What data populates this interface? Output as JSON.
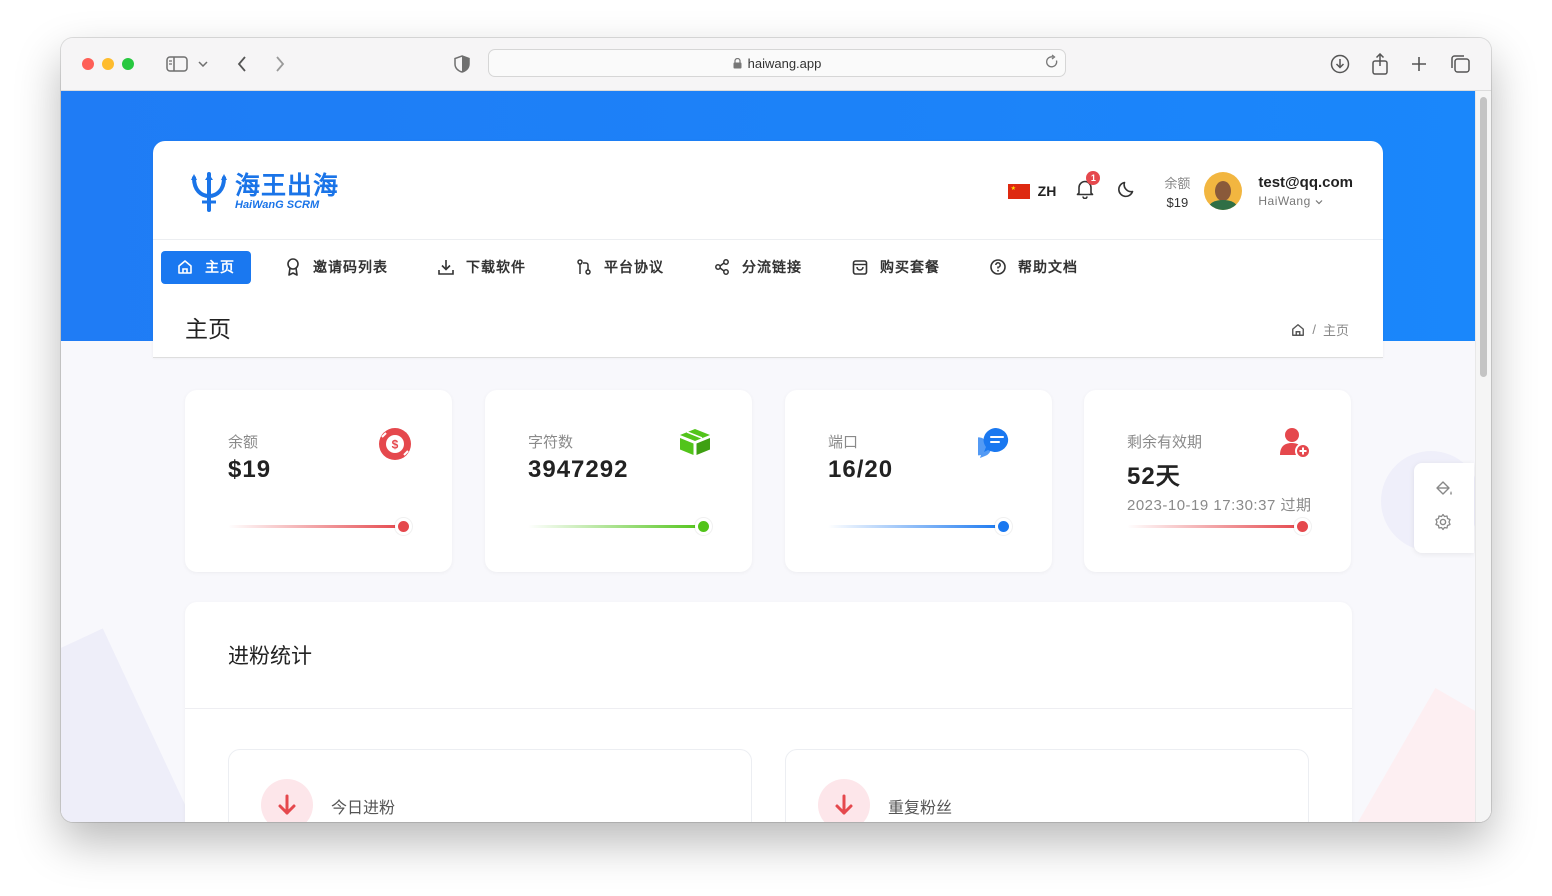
{
  "browser": {
    "url": "haiwang.app"
  },
  "brand": {
    "name": "海王出海",
    "subtitle": "HaiWanG SCRM"
  },
  "header": {
    "language": "ZH",
    "notification_count": "1",
    "balance_label": "余额",
    "balance_value": "$19",
    "user_email": "test@qq.com",
    "user_name": "HaiWang"
  },
  "nav": {
    "items": [
      {
        "label": "主页",
        "icon": "home-icon",
        "active": true
      },
      {
        "label": "邀请码列表",
        "icon": "award-icon"
      },
      {
        "label": "下载软件",
        "icon": "download-icon"
      },
      {
        "label": "平台协议",
        "icon": "git-compare-icon"
      },
      {
        "label": "分流链接",
        "icon": "share-icon"
      },
      {
        "label": "购买套餐",
        "icon": "shopping-bag-icon"
      },
      {
        "label": "帮助文档",
        "icon": "help-circle-icon"
      }
    ]
  },
  "page": {
    "title": "主页",
    "breadcrumb_current": "主页"
  },
  "stats": [
    {
      "label": "余额",
      "value": "$19",
      "icon": "dollar-circle-icon",
      "color": "#e5484d"
    },
    {
      "label": "字符数",
      "value": "3947292",
      "icon": "package-icon",
      "color": "#52c41a"
    },
    {
      "label": "端口",
      "value": "16/20",
      "icon": "chat-bubbles-icon",
      "color": "#1a78f0"
    },
    {
      "label": "剩余有效期",
      "value": "52天",
      "sub": "2023-10-19 17:30:37 过期",
      "icon": "user-plus-icon",
      "color": "#e5484d"
    }
  ],
  "fans": {
    "title": "进粉统计",
    "boxes": [
      {
        "label": "今日进粉",
        "icon": "arrow-down-icon"
      },
      {
        "label": "重复粉丝",
        "icon": "arrow-down-icon"
      }
    ]
  },
  "colors": {
    "primary": "#1a78f0",
    "danger": "#e5484d",
    "success": "#52c41a"
  }
}
